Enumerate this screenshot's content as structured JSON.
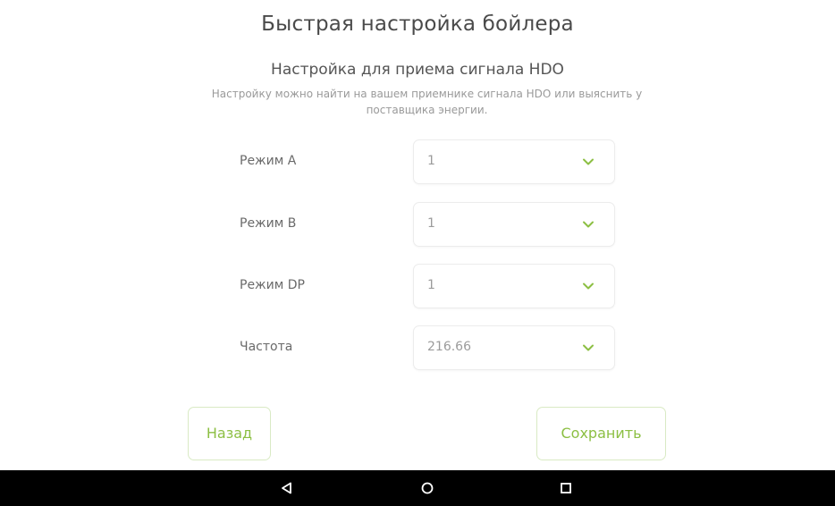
{
  "header": {
    "title": "Быстрая настройка бойлера",
    "subtitle": "Настройка для приема сигнала HDO",
    "hint": "Настройку можно найти на вашем приемнике сигнала HDO или выяснить у поставщика энергии."
  },
  "fields": [
    {
      "label": "Режим A",
      "value": "1"
    },
    {
      "label": "Режим B",
      "value": "1"
    },
    {
      "label": "Режим DP",
      "value": "1"
    },
    {
      "label": "Частота",
      "value": "216.66"
    }
  ],
  "buttons": {
    "back_label": "Назад",
    "save_label": "Сохранить"
  },
  "colors": {
    "accent": "#8cbf43",
    "navbar": "#000000"
  },
  "navbar": {
    "icons": [
      "back-icon",
      "home-icon",
      "recents-icon"
    ]
  }
}
